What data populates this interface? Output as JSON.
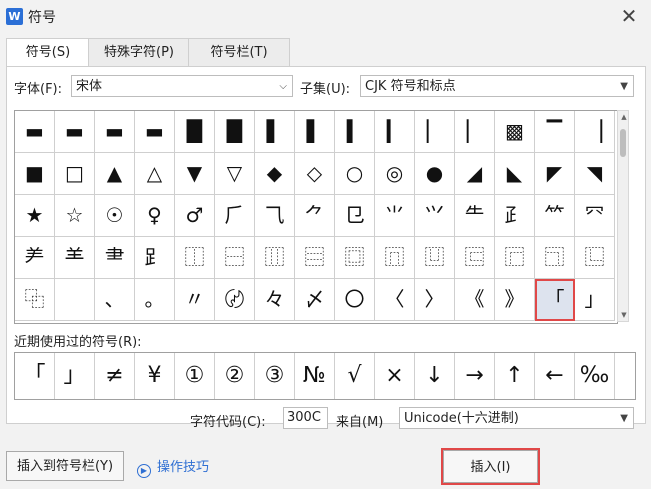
{
  "window": {
    "title": "符号",
    "app_icon": "W"
  },
  "tabs": [
    {
      "label": "符号(S)"
    },
    {
      "label": "特殊字符(P)"
    },
    {
      "label": "符号栏(T)"
    }
  ],
  "font": {
    "label": "字体(F):",
    "value": "宋体"
  },
  "subset": {
    "label": "子集(U):",
    "value": "CJK 符号和标点"
  },
  "grid": {
    "rows": [
      [
        "▬",
        "▬",
        "▬",
        "▬",
        "█",
        "█",
        "▌",
        "▌",
        "▍",
        "▎",
        "▏",
        "▏",
        "▩",
        "▔",
        "▕"
      ],
      [
        "■",
        "□",
        "▲",
        "△",
        "▼",
        "▽",
        "◆",
        "◇",
        "○",
        "◎",
        "●",
        "◢",
        "◣",
        "◤",
        "◥"
      ],
      [
        "★",
        "☆",
        "☉",
        "♀",
        "♂",
        "⺁",
        "⺄",
        "⺈",
        "⺋",
        "⺌",
        "⺍",
        "⺧",
        "⺪",
        "⺮",
        "⺳"
      ],
      [
        "⺶",
        "⺷",
        "⺻",
        "⻊",
        "⿰",
        "⿱",
        "⿲",
        "⿳",
        "⿴",
        "⿵",
        "⿶",
        "⿷",
        "⿸",
        "⿹",
        "⿺"
      ],
      [
        "⿻",
        "　",
        "、",
        "。",
        "〃",
        "〄",
        "々",
        "〆",
        "〇",
        "〈",
        "〉",
        "《",
        "》",
        "「",
        "」",
        "『"
      ]
    ]
  },
  "recent": {
    "label": "近期使用过的符号(R):",
    "items": [
      "「",
      "」",
      "≠",
      "¥",
      "①",
      "②",
      "③",
      "№",
      "√",
      "×",
      "↓",
      "→",
      "↑",
      "←",
      "‰"
    ]
  },
  "char_code": {
    "label": "字符代码(C):",
    "value": "300C"
  },
  "from": {
    "label": "来自(M)",
    "value": "Unicode(十六进制)"
  },
  "buttons": {
    "add_to_bar": "插入到符号栏(Y)",
    "tips": "操作技巧",
    "insert": "插入(I)"
  }
}
